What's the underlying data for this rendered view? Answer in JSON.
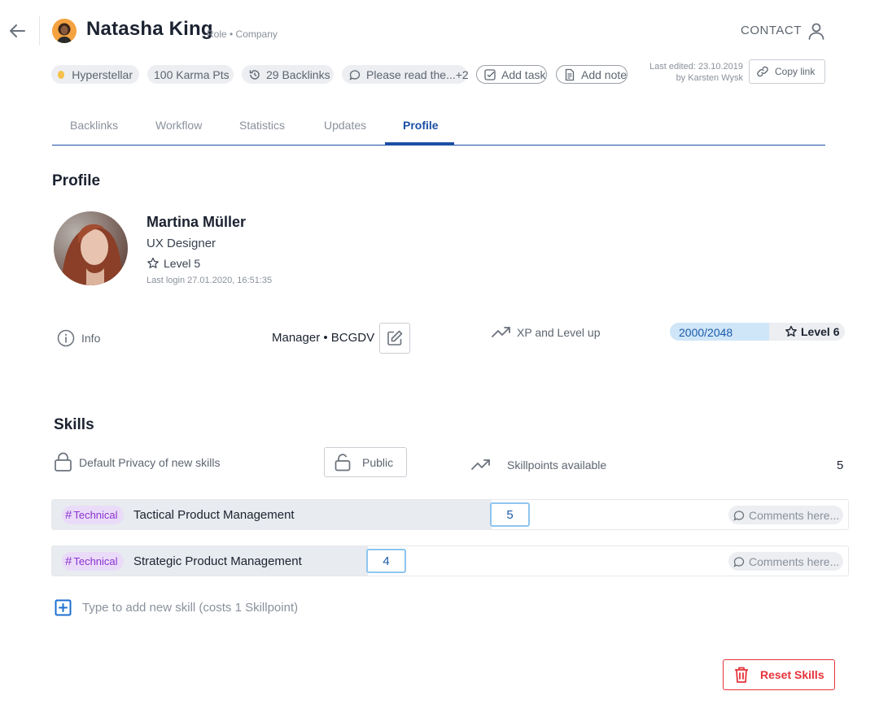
{
  "header": {
    "name": "Natasha King",
    "subtitle": "Role • Company",
    "contact_label": "CONTACT"
  },
  "chips": {
    "status": "Hyperstellar",
    "karma": "100 Karma Pts",
    "backlinks": "29 Backlinks",
    "comment": "Please read the...+2",
    "add_task": "Add task",
    "add_note": "Add note"
  },
  "last_edited": {
    "line1": "Last edited: 23.10.2019",
    "line2": "by Karsten Wysk"
  },
  "copy_link_label": "Copy link",
  "tabs": [
    {
      "label": "Backlinks"
    },
    {
      "label": "Workflow"
    },
    {
      "label": "Statistics"
    },
    {
      "label": "Updates"
    },
    {
      "label": "Profile",
      "active": true
    }
  ],
  "profile": {
    "section_title": "Profile",
    "name": "Martina Müller",
    "role": "UX Designer",
    "level": "Level 5",
    "last_login": "Last login 27.01.2020, 16:51:35",
    "info_label": "Info",
    "manager": "Manager • BCGDV",
    "xp_label": "XP and Level up",
    "xp_value": "2000/2048",
    "xp_fraction": 0.977,
    "next_level": "Level 6"
  },
  "skills": {
    "section_title": "Skills",
    "privacy_label": "Default Privacy of new skills",
    "privacy_value": "Public",
    "skillpoints_label": "Skillpoints available",
    "skillpoints_value": "5",
    "items": [
      {
        "tag": "Technical",
        "name": "Tactical Product Management",
        "points": "5",
        "comment": "Comments here..."
      },
      {
        "tag": "Technical",
        "name": "Strategic Product Management",
        "points": "4",
        "comment": "Comments here..."
      }
    ],
    "add_placeholder": "Type to add new skill  (costs 1 Skillpoint)",
    "reset_label": "Reset Skills"
  },
  "colors": {
    "accent": "#1c4fa5",
    "status_dot": "#f6c04a",
    "tag_bg": "#eadcf9",
    "tag_text": "#8b32cf",
    "danger": "#e5333a",
    "xp_fill": "#cfe6f8"
  }
}
